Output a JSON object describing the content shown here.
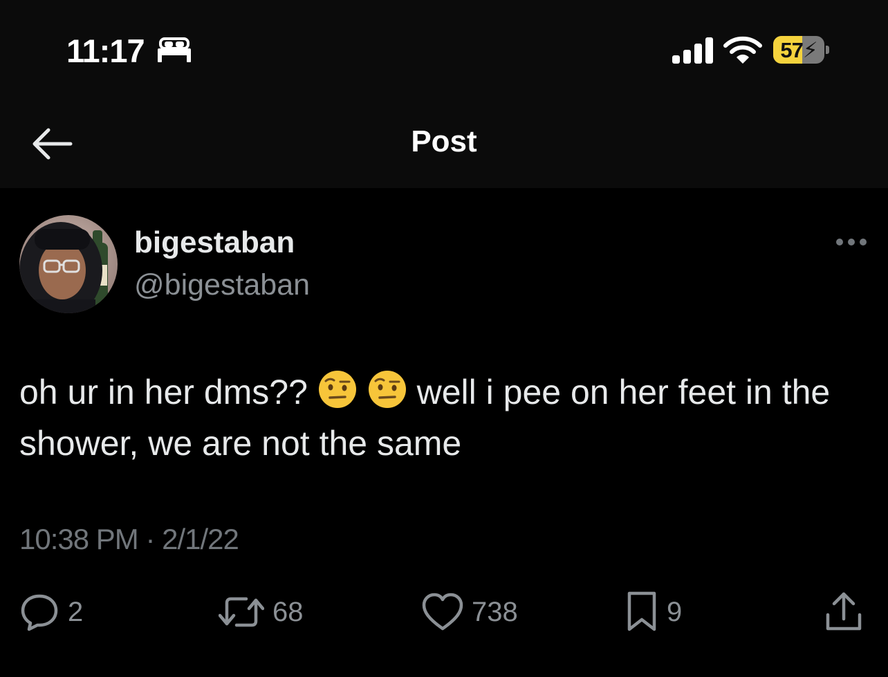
{
  "status_bar": {
    "time": "11:17",
    "focus_icon": "bed-icon",
    "signal_icon": "signal-icon",
    "wifi_icon": "wifi-icon",
    "battery_percent": "57",
    "battery_level": 0.57,
    "battery_charging": true,
    "battery_color": "#f5d33d"
  },
  "nav": {
    "back_icon": "back-arrow-icon",
    "title": "Post"
  },
  "author": {
    "display_name": "bigestaban",
    "handle": "@bigestaban",
    "more_icon": "more-icon"
  },
  "tweet": {
    "text_part1": "oh ur in her dms??",
    "emoji": [
      "face-with-raised-eyebrow-emoji",
      "face-with-raised-eyebrow-emoji"
    ],
    "text_part2": "well i pee on her feet in the shower, we are not the same",
    "timestamp": "10:38 PM · 2/1/22"
  },
  "actions": {
    "replies": {
      "icon": "reply-icon",
      "count": "2"
    },
    "reposts": {
      "icon": "repost-icon",
      "count": "68"
    },
    "likes": {
      "icon": "heart-icon",
      "count": "738"
    },
    "bookmarks": {
      "icon": "bookmark-icon",
      "count": "9"
    },
    "share": {
      "icon": "share-icon"
    }
  },
  "colors": {
    "background": "#000000",
    "header_background": "#0b0b0b",
    "primary_text": "#e7e9ea",
    "secondary_text": "#71767b"
  }
}
